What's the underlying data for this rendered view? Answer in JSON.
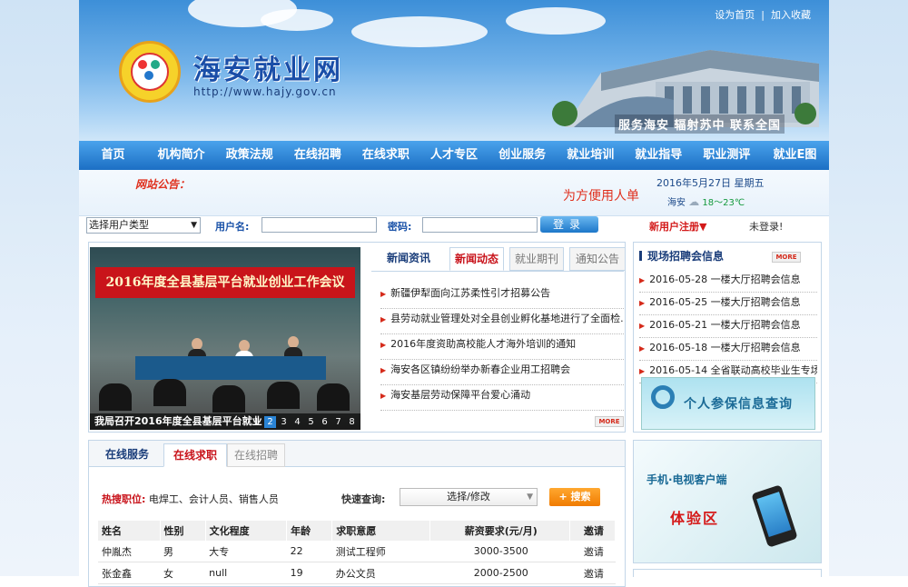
{
  "header": {
    "top_links": [
      "设为首页",
      "加入收藏"
    ],
    "site_name": "海安就业网",
    "url": "http://www.hajy.gov.cn",
    "slogan": "服务海安 辐射苏中 联系全国"
  },
  "nav": {
    "items": [
      "首页",
      "机构简介",
      "政策法规",
      "在线招聘",
      "在线求职",
      "人才专区",
      "创业服务",
      "就业培训",
      "就业指导",
      "职业测评",
      "就业E图"
    ]
  },
  "announce": {
    "label": "网站公告：",
    "text": "为方便用人单",
    "date": "2016年5月27日 星期五",
    "city": "海安",
    "temp": "18～23℃"
  },
  "login": {
    "user_type": "选择用户类型",
    "username_label": "用户名:",
    "password_label": "密码:",
    "login_button": "登录",
    "register": "新用户注册▼",
    "status": "未登录!"
  },
  "photo": {
    "banner": "2016年度全县基层平台就业创业工作会议",
    "caption": "我局召开2016年度全县基层平台就业",
    "pages": [
      "1",
      "2",
      "3",
      "4",
      "5",
      "6",
      "7",
      "8"
    ],
    "active_page": "2"
  },
  "news": {
    "title": "新闻资讯",
    "tabs": [
      "新闻动态",
      "就业期刊",
      "通知公告"
    ],
    "items": [
      "新疆伊犁面向江苏柔性引才招募公告",
      "县劳动就业管理处对全县创业孵化基地进行了全面检...",
      "2016年度资助高校能人才海外培训的通知",
      "海安各区镇纷纷举办新春企业用工招聘会",
      "海安基层劳动保障平台爱心涌动"
    ],
    "more": "MORE"
  },
  "recruit": {
    "title": "现场招聘会信息",
    "more": "MORE",
    "items": [
      "2016-05-28 一楼大厅招聘会信息",
      "2016-05-25 一楼大厅招聘会信息",
      "2016-05-21 一楼大厅招聘会信息",
      "2016-05-18 一楼大厅招聘会信息",
      "2016-05-14 全省联动高校毕业生专场..."
    ],
    "personal_query": "个人参保信息查询"
  },
  "service": {
    "tabs": [
      "在线服务",
      "在线求职",
      "在线招聘"
    ],
    "hot_label": "热搜职位:",
    "hot_jobs": "电焊工、会计人员、销售人员",
    "quick_label": "快速查询:",
    "quick_select": "选择/修改",
    "search_button": "+ 搜索",
    "columns": [
      "姓名",
      "性别",
      "文化程度",
      "年龄",
      "求职意愿",
      "薪资要求(元/月)",
      "邀请"
    ],
    "rows": [
      [
        "仲胤杰",
        "男",
        "大专",
        "22",
        "测试工程师",
        "3000-3500",
        "邀请"
      ],
      [
        "张金鑫",
        "女",
        "null",
        "19",
        "办公文员",
        "2000-2500",
        "邀请"
      ]
    ]
  },
  "mobile": {
    "line1": "手机·电视客户端",
    "line2": "体验区"
  }
}
